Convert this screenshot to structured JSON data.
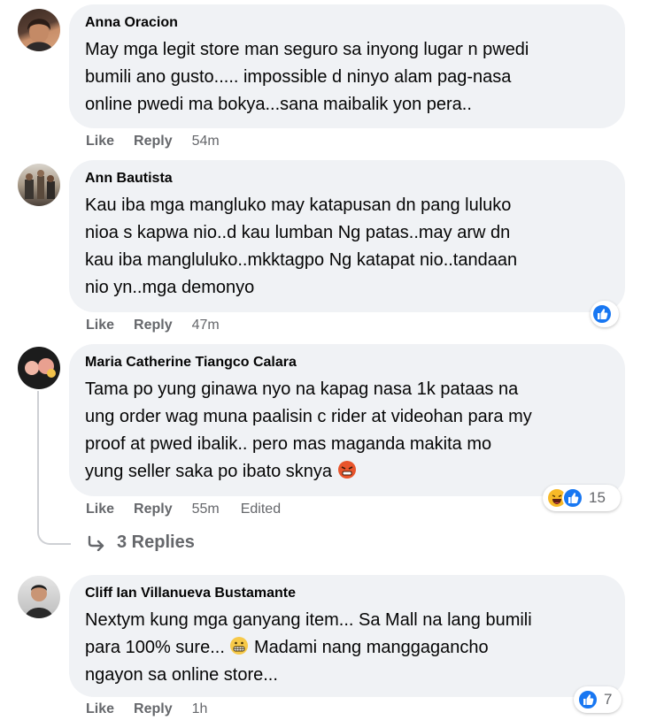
{
  "colors": {
    "bubble": "#f0f2f5",
    "meta_text": "#65676b",
    "like_blue": "#1877f2",
    "haha_yellow": "#f7b928"
  },
  "comments": [
    {
      "author": "Anna Oracion",
      "text": "May mga legit store man seguro sa inyong lugar n pwedi\nbumili ano gusto..... impossible d ninyo alam pag-nasa\nonline pwedi ma bokya...sana maibalik yon pera..",
      "like": "Like",
      "reply": "Reply",
      "time": "54m"
    },
    {
      "author": "Ann Bautista",
      "text": "Kau iba mga mangluko may katapusan dn pang luluko\nnioa s kapwa nio..d kau lumban Ng patas..may arw dn\nkau iba mangluluko..mkktagpo Ng katapat nio..tandaan\nnio yn..mga demonyo",
      "like": "Like",
      "reply": "Reply",
      "time": "47m",
      "reactions": [
        "like-icon"
      ]
    },
    {
      "author": "Maria Catherine Tiangco Calara",
      "text": "Tama po yung ginawa nyo na kapag nasa 1k pataas na\nung order wag muna paalisin c rider at videohan para my\nproof at pwed ibalik.. pero mas maganda makita mo\nyung seller saka po ibato sknya",
      "emoji": "angry-face-emoji",
      "like": "Like",
      "reply": "Reply",
      "time": "55m",
      "edited": "Edited",
      "reactions": [
        "haha-icon",
        "like-icon"
      ],
      "reaction_count": "15",
      "replies_label": "3 Replies"
    },
    {
      "author": "Cliff Ian Villanueva Bustamante",
      "text_before_emoji": "Nextym kung mga ganyang item... Sa Mall na lang bumili\npara 100% sure...",
      "emoji": "grimacing-face-emoji",
      "text_after_emoji": " Madami nang manggagancho\nngayon sa online store...",
      "like": "Like",
      "reply": "Reply",
      "time": "1h",
      "reactions": [
        "like-icon"
      ],
      "reaction_count": "7"
    }
  ]
}
